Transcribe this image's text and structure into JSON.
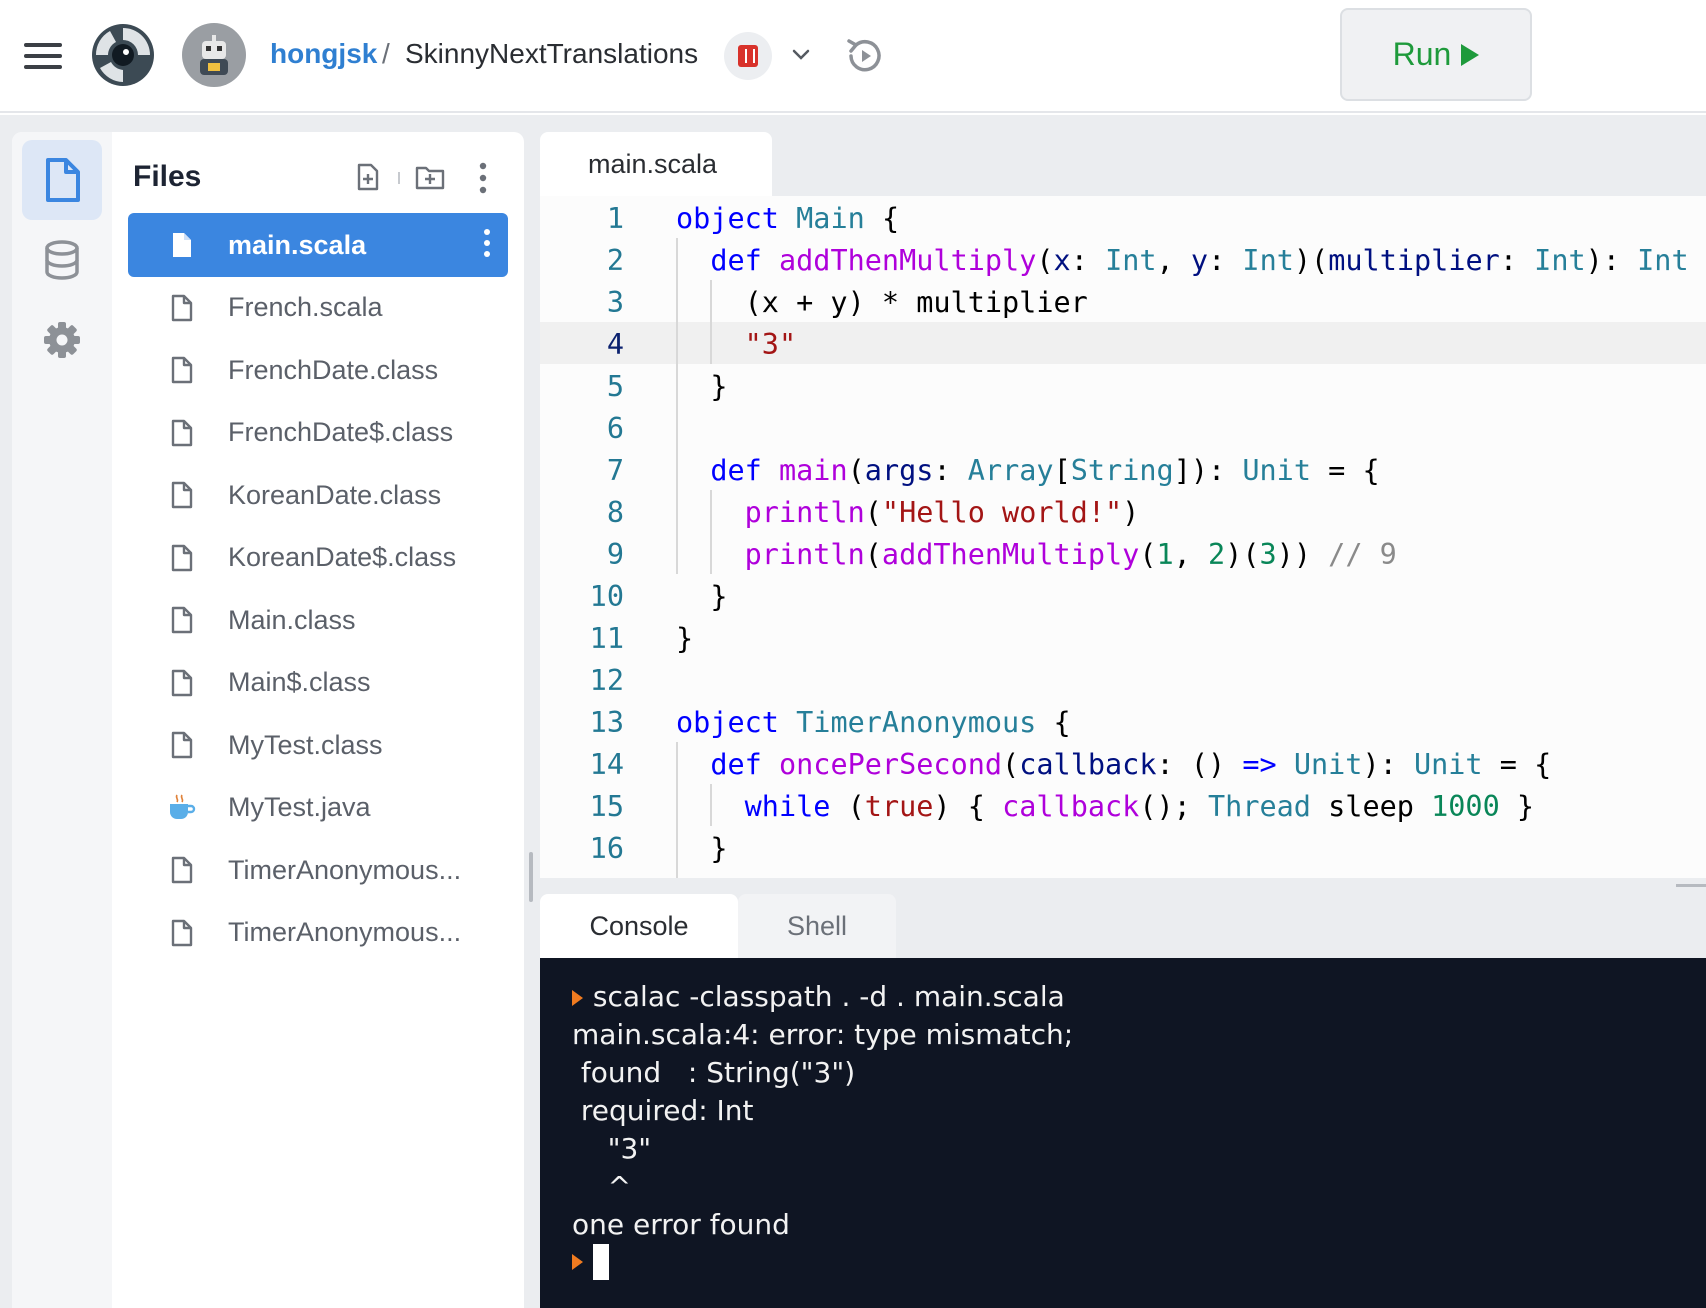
{
  "header": {
    "user": "hongjsk",
    "separator": "/",
    "repo": "SkinnyNextTranslations",
    "run_label": "Run",
    "accent": "#2f7fd1",
    "run_color": "#1e9a3b"
  },
  "sidebar": {
    "title": "Files",
    "files": [
      {
        "name": "main.scala",
        "icon": "file-icon",
        "active": true
      },
      {
        "name": "French.scala",
        "icon": "file-icon"
      },
      {
        "name": "FrenchDate.class",
        "icon": "file-icon"
      },
      {
        "name": "FrenchDate$.class",
        "icon": "file-icon"
      },
      {
        "name": "KoreanDate.class",
        "icon": "file-icon"
      },
      {
        "name": "KoreanDate$.class",
        "icon": "file-icon"
      },
      {
        "name": "Main.class",
        "icon": "file-icon"
      },
      {
        "name": "Main$.class",
        "icon": "file-icon"
      },
      {
        "name": "MyTest.class",
        "icon": "file-icon"
      },
      {
        "name": "MyTest.java",
        "icon": "java-cup-icon"
      },
      {
        "name": "TimerAnonymous...",
        "icon": "file-icon"
      },
      {
        "name": "TimerAnonymous...",
        "icon": "file-icon"
      }
    ]
  },
  "editor": {
    "tab": "main.scala",
    "current_line": 4,
    "lines": [
      {
        "n": "1"
      },
      {
        "n": "2"
      },
      {
        "n": "3"
      },
      {
        "n": "4"
      },
      {
        "n": "5"
      },
      {
        "n": "6"
      },
      {
        "n": "7"
      },
      {
        "n": "8"
      },
      {
        "n": "9"
      },
      {
        "n": "10"
      },
      {
        "n": "11"
      },
      {
        "n": "12"
      },
      {
        "n": "13"
      },
      {
        "n": "14"
      },
      {
        "n": "15"
      },
      {
        "n": "16"
      }
    ]
  },
  "console": {
    "tabs": [
      "Console",
      "Shell"
    ],
    "command": " scalac -classpath . -d . main.scala",
    "output": [
      "main.scala:4: error: type mismatch;",
      " found   : String(\"3\")",
      " required: Int",
      "    \"3\"",
      "    ^",
      "one error found"
    ],
    "prompt_color": "#f07b20"
  }
}
